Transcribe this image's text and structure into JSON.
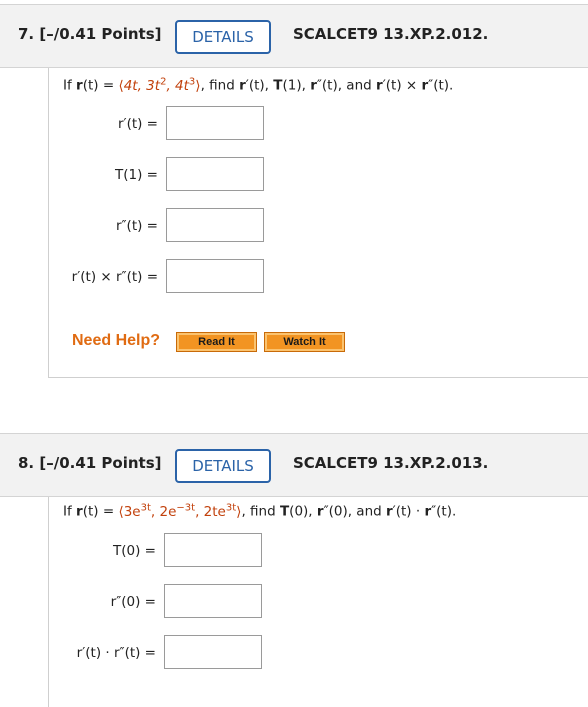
{
  "q7": {
    "number": "7.  [–/0.41 Points]",
    "details": "DETAILS",
    "course": "SCALCET9 13.XP.2.012.",
    "prompt": {
      "p1": "If ",
      "r": "r",
      "p2": "(t) = ",
      "vec_open": "⟨",
      "c1": "4t, 3t",
      "e1": "2",
      "c2": ", 4t",
      "e2": "3",
      "vec_close": "⟩",
      "p3": ", find ",
      "rp": "r",
      "p4": "′(t), ",
      "T": "T",
      "p5": "(1), ",
      "rpp": "r",
      "p6": "″(t), and ",
      "rp2": "r",
      "p7": "′(t) × ",
      "rpp2": "r",
      "p8": "″(t)."
    },
    "labels": [
      "r′(t)  =",
      "T(1)  =",
      "r″(t)  =",
      "r′(t) × r″(t)  ="
    ],
    "need_help": "Need Help?",
    "read_it": "Read It",
    "watch_it": "Watch It"
  },
  "q8": {
    "number": "8.  [–/0.41 Points]",
    "details": "DETAILS",
    "course": "SCALCET9 13.XP.2.013.",
    "prompt": {
      "p1": "If ",
      "r": "r",
      "p2": "(t) = ",
      "vec_open": "⟨",
      "c1": "3e",
      "e1": "3t",
      "c2": ", 2e",
      "e2": "−3t",
      "c3": ", 2te",
      "e3": "3t",
      "vec_close": "⟩",
      "p3": ", find ",
      "T": "T",
      "p4": "(0), ",
      "rpp": "r",
      "p5": "″(0), and ",
      "rp": "r",
      "p6": "′(t) · ",
      "rpp2": "r",
      "p7": "″(t)."
    },
    "labels": [
      "T(0)  =",
      "r″(0)  =",
      "r′(t) · r″(t)  ="
    ]
  }
}
